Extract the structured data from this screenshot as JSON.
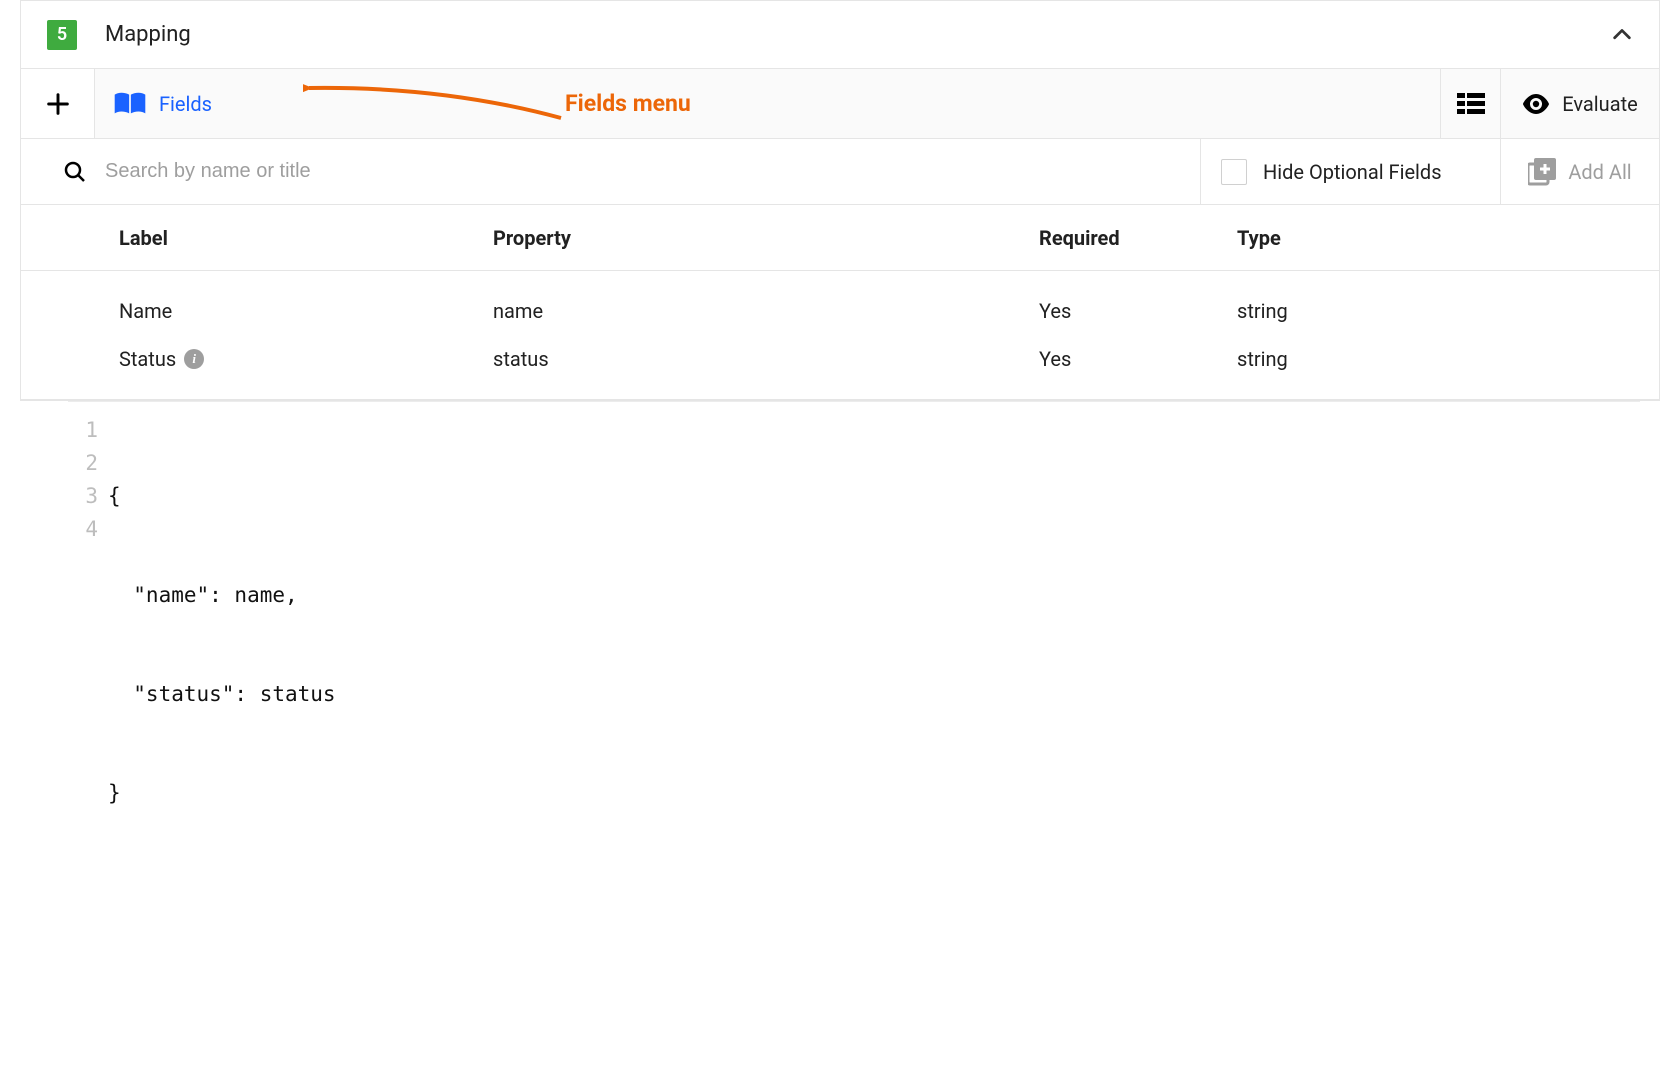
{
  "section": {
    "step": "5",
    "title": "Mapping"
  },
  "toolbar": {
    "fields_label": "Fields",
    "evaluate_label": "Evaluate"
  },
  "search": {
    "placeholder": "Search by name or title",
    "hide_optional_label": "Hide Optional Fields",
    "add_all_label": "Add All"
  },
  "table": {
    "headers": {
      "label": "Label",
      "property": "Property",
      "required": "Required",
      "type": "Type"
    },
    "rows": [
      {
        "label": "Name",
        "property": "name",
        "required": "Yes",
        "type": "string",
        "has_info": false
      },
      {
        "label": "Status",
        "property": "status",
        "required": "Yes",
        "type": "string",
        "has_info": true
      }
    ]
  },
  "code": {
    "lines": [
      "{",
      "  \"name\": name,",
      "  \"status\": status",
      "}"
    ]
  },
  "annotation": {
    "label": "Fields menu"
  },
  "colors": {
    "accent_blue": "#1a62ff",
    "step_green": "#3fab3f",
    "annotation_orange": "#ec6608"
  }
}
